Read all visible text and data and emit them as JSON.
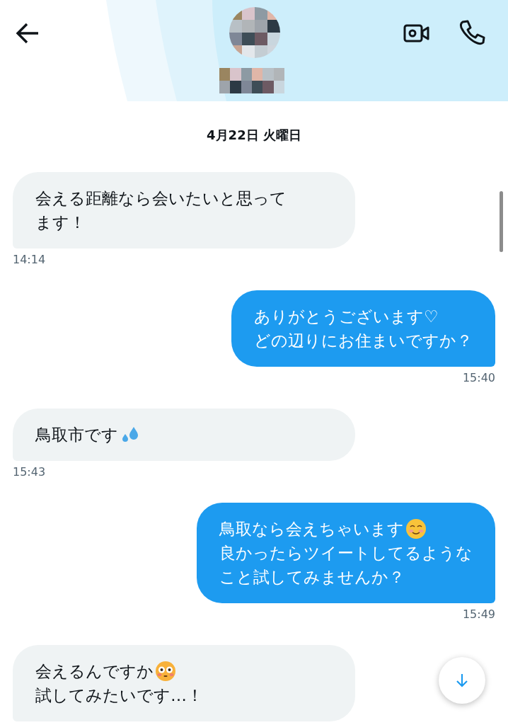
{
  "header": {
    "avatar": {
      "kind": "pixelated"
    },
    "name": {
      "kind": "pixelated"
    }
  },
  "date": "4月22日 火曜日",
  "messages": [
    {
      "kind": "received",
      "lines": [
        {
          "kind": "plain",
          "text": "会える距離なら会いたいと思って"
        },
        {
          "kind": "plain",
          "text": "ます！"
        }
      ],
      "time": "14:14"
    },
    {
      "kind": "sent",
      "lines": [
        {
          "kind": "plain",
          "text": "ありがとうございます♡"
        },
        {
          "kind": "plain",
          "text": "どの辺りにお住まいですか？"
        }
      ],
      "time": "15:40"
    },
    {
      "kind": "received",
      "lines": [
        {
          "kind": "droplets",
          "text": "鳥取市です"
        }
      ],
      "time": "15:43"
    },
    {
      "kind": "sent",
      "lines": [
        {
          "kind": "smile",
          "text": "鳥取なら会えちゃいます"
        },
        {
          "kind": "plain",
          "text": "良かったらツイートしてるような"
        },
        {
          "kind": "plain",
          "text": "こと試してみませんか？"
        }
      ],
      "time": "15:49"
    },
    {
      "kind": "received",
      "lines": [
        {
          "kind": "flushed",
          "text": "会えるんですか"
        },
        {
          "kind": "plain",
          "text": "試してみたいです…！"
        }
      ]
    }
  ]
}
